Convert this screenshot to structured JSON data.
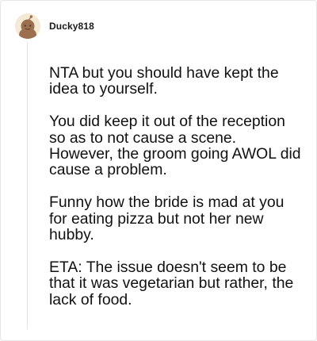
{
  "comment": {
    "username": "Ducky818",
    "avatar_icon": "snoo-avatar-icon",
    "paragraphs": [
      "NTA but you should have kept the idea to yourself.",
      "You did keep it out of the reception so as to not cause a scene. However, the groom going AWOL did cause a problem.",
      "Funny how the bride is mad at you for eating pizza but not her new hubby.",
      "ETA: The issue doesn't seem to be that it was vegetarian but rather, the lack of food."
    ]
  },
  "colors": {
    "avatar_background": "#f3e9d5",
    "avatar_figure": "#9b6f4f",
    "thread_line": "#e3e3e3",
    "text": "#111111"
  }
}
